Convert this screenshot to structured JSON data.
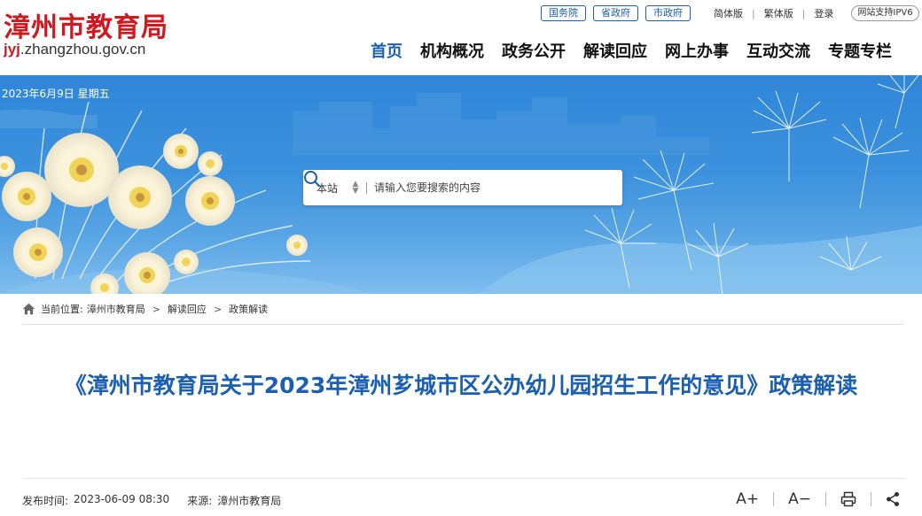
{
  "header": {
    "logo_name": "漳州市教育局",
    "logo_url_prefix": "jyj",
    "logo_url_rest": ".zhangzhou.gov.cn",
    "top_pills": [
      "国务院",
      "省政府",
      "市政府"
    ],
    "top_links": [
      "简体版",
      "繁体版",
      "登录"
    ],
    "ipv6": "网站支持IPV6",
    "nav": [
      "首页",
      "机构概况",
      "政务公开",
      "解读回应",
      "网上办事",
      "互动交流",
      "专题专栏"
    ],
    "active_nav": "首页"
  },
  "banner": {
    "date": "2023年6月9日 星期五"
  },
  "search": {
    "scope": "本站",
    "placeholder": "请输入您要搜索的内容"
  },
  "breadcrumb": {
    "label": "当前位置:",
    "items": [
      "漳州市教育局",
      "解读回应",
      "政策解读"
    ],
    "separator": ">"
  },
  "article": {
    "title": "《漳州市教育局关于2023年漳州芗城市区公办幼儿园招生工作的意见》政策解读",
    "publish_label": "发布时间:",
    "publish_time": "2023-06-09 08:30",
    "source_label": "来源:",
    "source": "漳州市教育局"
  },
  "tools": {
    "font_larger": "A+",
    "font_smaller": "A−"
  },
  "colors": {
    "brand_red": "#d2181f",
    "brand_blue": "#1b5fb2"
  }
}
